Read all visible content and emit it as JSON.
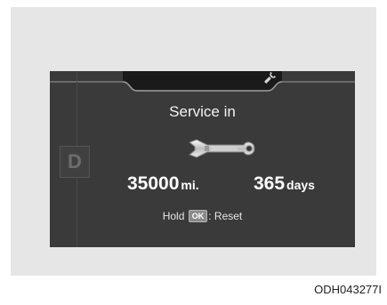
{
  "display": {
    "title": "Service in",
    "gear_indicator": "D",
    "distance": {
      "value": "35000",
      "unit": "mi."
    },
    "time": {
      "value": "365",
      "unit": "days"
    },
    "reset_hint": {
      "prefix": "Hold",
      "button_label": "OK",
      "suffix": ": Reset"
    },
    "icons": {
      "top_bar": "wrench-icon",
      "center": "wrench-icon"
    }
  },
  "figure_code": "ODH043277I",
  "colors": {
    "display_background": "#3a3a3a",
    "frame_background": "#e6e6e6",
    "text": "#ffffff"
  }
}
